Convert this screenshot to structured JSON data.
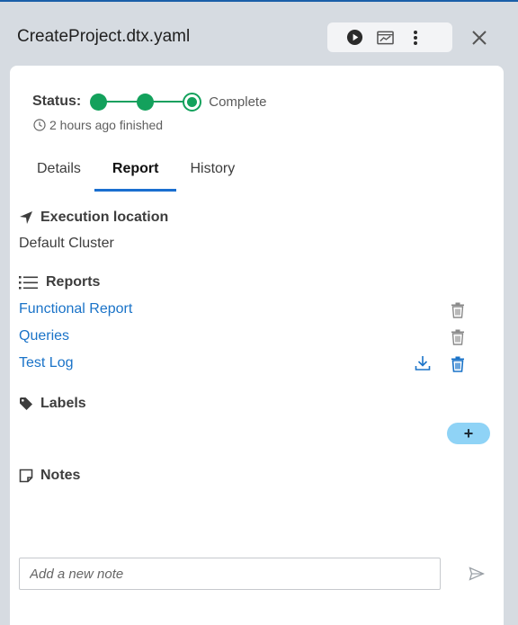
{
  "window": {
    "title": "CreateProject.dtx.yaml"
  },
  "toolbar": {
    "run_icon": "play-circle-icon",
    "dashboard_icon": "chart-window-icon",
    "more_icon": "kebab-menu-icon",
    "close_icon": "close-icon"
  },
  "status": {
    "label": "Status:",
    "steps_total": 3,
    "steps_completed": 3,
    "value": "Complete",
    "finished": "2 hours ago finished",
    "color": "#13a15c"
  },
  "tabs": [
    {
      "label": "Details",
      "active": false
    },
    {
      "label": "Report",
      "active": true
    },
    {
      "label": "History",
      "active": false
    }
  ],
  "execution": {
    "heading": "Execution location",
    "value": "Default Cluster"
  },
  "reports": {
    "heading": "Reports",
    "items": [
      {
        "label": "Functional Report",
        "download": false
      },
      {
        "label": "Queries",
        "download": false
      },
      {
        "label": "Test Log",
        "download": true
      }
    ]
  },
  "labels": {
    "heading": "Labels",
    "add_label": "+"
  },
  "notes": {
    "heading": "Notes",
    "placeholder": "Add a new note",
    "value": ""
  },
  "colors": {
    "accent": "#1a73c8",
    "add_button": "#8fd3f6",
    "background": "#d6dbe1"
  }
}
